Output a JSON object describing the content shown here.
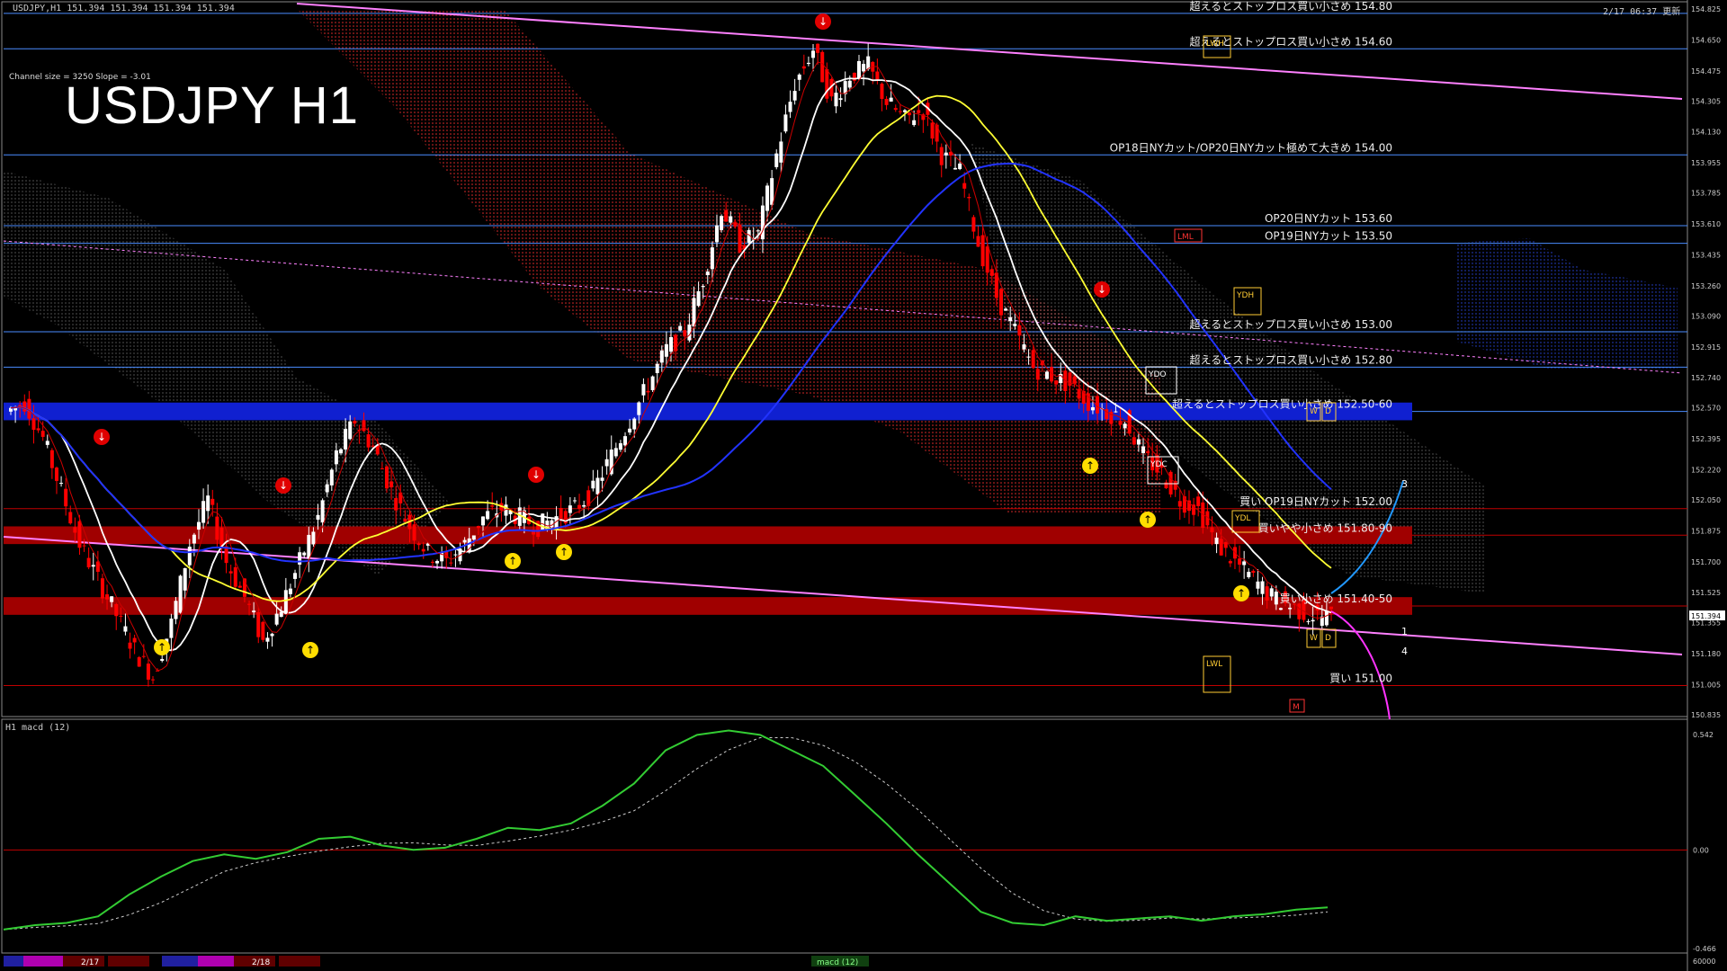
{
  "header": {
    "symbol_line": "USDJPY,H1 151.394 151.394 151.394 151.394",
    "datetime": "2/17 06:37 更新",
    "channel_info": "Channel size = 3250 Slope = -3.01",
    "big_title": "USDJPY H1"
  },
  "colors": {
    "background": "#000000",
    "bull": "#ffffff",
    "bear": "#ff0000",
    "blue_level": "#4a8cff",
    "red_level": "#c00000",
    "cloud": "#ff4040",
    "macd_main": "#33cc33",
    "macd_down": "#ff6aa0"
  },
  "indicator": {
    "title": "H1 macd (12)",
    "max": "0.542",
    "zero": "0.00",
    "min": "-0.466",
    "bottom": "60000"
  },
  "date_bar": {
    "d1": "2/17",
    "d2": "2/18",
    "macd_label": "macd (12)"
  },
  "price_axis": [
    "154.825",
    "154.650",
    "154.475",
    "154.305",
    "154.130",
    "153.955",
    "153.785",
    "153.610",
    "153.435",
    "153.260",
    "153.090",
    "152.915",
    "152.740",
    "152.570",
    "152.395",
    "152.220",
    "152.050",
    "151.875",
    "151.700",
    "151.525",
    "151.355",
    "151.180",
    "151.005",
    "150.835"
  ],
  "current_price": "151.394",
  "annotations": {
    "a1": "超えるとストップロス買い小さめ 154.80",
    "a2": "超えるとストップロス買い小さめ 154.60",
    "a3": "OP18日NYカット/OP20日NYカット極めて大きめ 154.00",
    "a4": "OP20日NYカット 153.60",
    "a5": "OP19日NYカット 153.50",
    "a6": "超えるとストップロス買い小さめ 153.00",
    "a7": "超えるとストップロス買い小さめ 152.80",
    "a8": "超えるとストップロス買い小さめ 152.50-60",
    "a9": "買い OP19日NYカット 152.00",
    "a10": "買いやや小さめ 151.80-90",
    "a11": "買い小さめ 151.40-50",
    "a12": "買い 151.00"
  },
  "markers": {
    "lwh": "LWH",
    "lml": "LML",
    "ydh": "YDH",
    "ydo": "YDO",
    "ydc": "YDC",
    "ydl": "YDL",
    "lwl": "LWL",
    "m": "M",
    "w": "W",
    "d": "D",
    "n1": "1",
    "n3": "3",
    "n4": "4"
  },
  "chart_data": {
    "type": "candlestick",
    "symbol": "USDJPY",
    "timeframe": "H1",
    "ylim": [
      150.835,
      154.825
    ],
    "x_ticks": [
      "2/17",
      "2/18"
    ],
    "levels": [
      154.8,
      154.6,
      154.0,
      153.6,
      153.5,
      153.0,
      152.8,
      152.55,
      152.0,
      151.85,
      151.45,
      151.0
    ],
    "price_path": [
      152.55,
      152.6,
      152.4,
      152.1,
      151.8,
      151.6,
      151.4,
      151.2,
      151.05,
      151.35,
      151.8,
      152.05,
      151.7,
      151.5,
      151.25,
      151.45,
      151.7,
      151.95,
      152.3,
      152.5,
      152.35,
      152.1,
      151.9,
      151.75,
      151.7,
      151.8,
      151.95,
      152.0,
      151.95,
      151.9,
      151.95,
      152.0,
      152.1,
      152.3,
      152.5,
      152.7,
      152.9,
      153.0,
      153.3,
      153.7,
      153.5,
      153.55,
      154.0,
      154.4,
      154.6,
      154.3,
      154.45,
      154.5,
      154.3,
      154.2,
      154.25,
      154.0,
      153.9,
      153.5,
      153.2,
      153.0,
      152.8,
      152.75,
      152.7,
      152.6,
      152.55,
      152.5,
      152.3,
      152.2,
      152.05,
      152.0,
      151.8,
      151.7,
      151.6,
      151.5,
      151.45,
      151.4,
      151.39
    ],
    "macd_path": [
      -0.36,
      -0.34,
      -0.33,
      -0.3,
      -0.2,
      -0.12,
      -0.05,
      -0.02,
      -0.04,
      -0.01,
      0.05,
      0.06,
      0.02,
      0.0,
      0.01,
      0.05,
      0.1,
      0.09,
      0.12,
      0.2,
      0.3,
      0.45,
      0.52,
      0.54,
      0.52,
      0.45,
      0.38,
      0.25,
      0.12,
      -0.02,
      -0.15,
      -0.28,
      -0.33,
      -0.34,
      -0.3,
      -0.32,
      -0.31,
      -0.3,
      -0.32,
      -0.3,
      -0.29,
      -0.27,
      -0.26
    ]
  }
}
